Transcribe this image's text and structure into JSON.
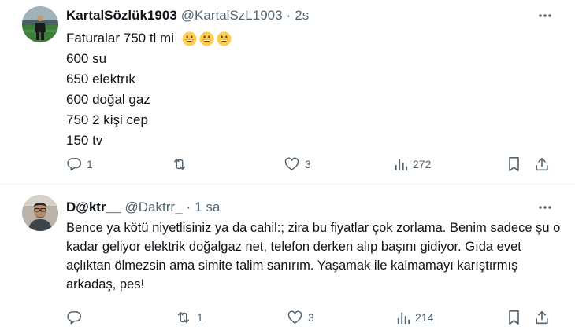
{
  "tweets": [
    {
      "display_name": "KartalSözlük1903",
      "handle": "@KartalSzL1903",
      "separator": "·",
      "time": "2s",
      "avatar": "avatar-soccer-player",
      "lines": [
        "Faturalar 750 tl mi",
        "600 su",
        "650 elektrık",
        "600 doğal gaz",
        "750 2 kişi cep",
        "150 tv"
      ],
      "emojis": [
        "grinning-face-icon",
        "grinning-face-icon",
        "grinning-face-icon"
      ],
      "actions": {
        "replies": "1",
        "reposts": "",
        "likes": "3",
        "views": "272"
      }
    },
    {
      "display_name": "D@ktr__",
      "handle": "@Daktrr_",
      "separator": "·",
      "time": "1 sa",
      "avatar": "avatar-man-glasses",
      "text": "Bence ya kötü niyetlisiniz ya da cahil:; zira bu fiyatlar çok zorlama. Benim sadece şu o kadar geliyor elektrik doğalgaz net, telefon derken alıp başını gidiyor. Gıda evet açlıktan ölmezsin ama simite talim sanırım. Yaşamak ile kalmamayı karıştırmış arkadaş, pes!",
      "actions": {
        "replies": "",
        "reposts": "1",
        "likes": "3",
        "views": "214"
      }
    }
  ],
  "colors": {
    "text": "#0f1419",
    "muted": "#536471",
    "divider": "#eff3f4",
    "emoji": "#ffcc4d"
  }
}
